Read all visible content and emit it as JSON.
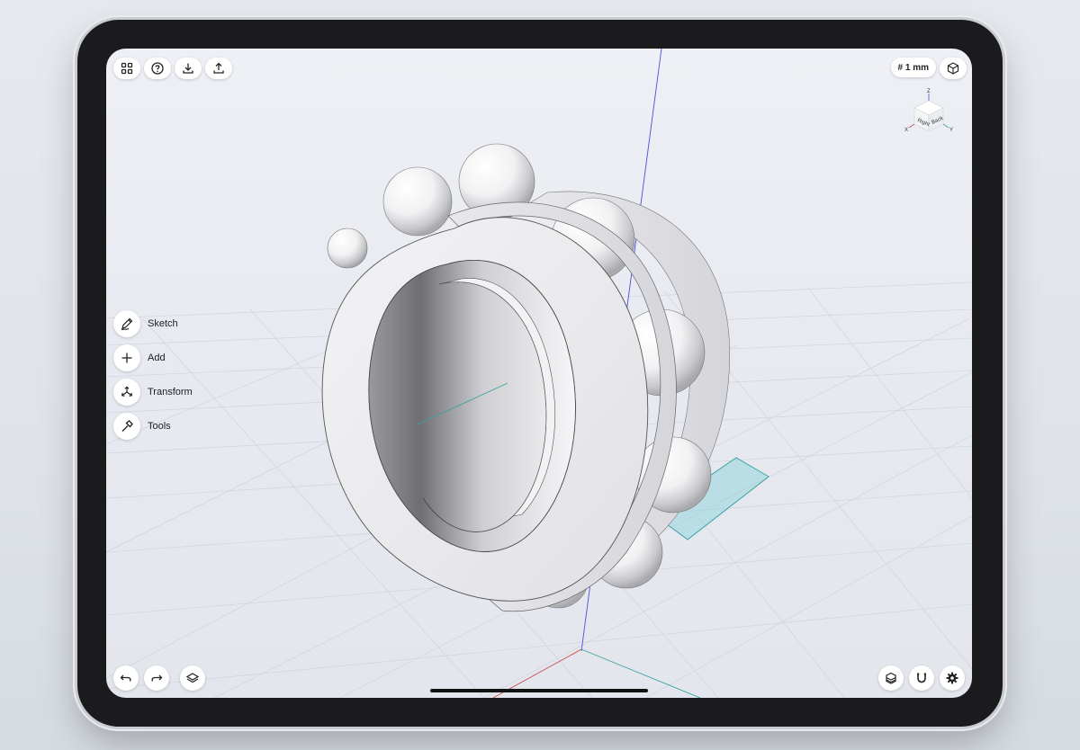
{
  "toolbar_top_left": {
    "icons": [
      "grid-icon",
      "help-icon",
      "import-icon",
      "export-icon"
    ]
  },
  "unit_label": "# 1 mm",
  "viewcube": {
    "face_front": "Right",
    "face_side": "Back",
    "axis_x": "X",
    "axis_y": "Y",
    "axis_z": "Z"
  },
  "side_menu": [
    {
      "label": "Sketch",
      "icon": "pencil-icon"
    },
    {
      "label": "Add",
      "icon": "plus-icon"
    },
    {
      "label": "Transform",
      "icon": "transform-icon"
    },
    {
      "label": "Tools",
      "icon": "hammer-icon"
    }
  ],
  "bottom_left": [
    "undo-icon",
    "redo-icon",
    "layers-icon"
  ],
  "bottom_right": [
    "material-icon",
    "magnet-icon",
    "settings-icon"
  ],
  "colors": {
    "grid": "#c9cdd6",
    "axis_blue": "#4a4fd8",
    "axis_red": "#c85050",
    "axis_green": "#3aa3a3",
    "sketch_plane": "#8fd3dc"
  }
}
